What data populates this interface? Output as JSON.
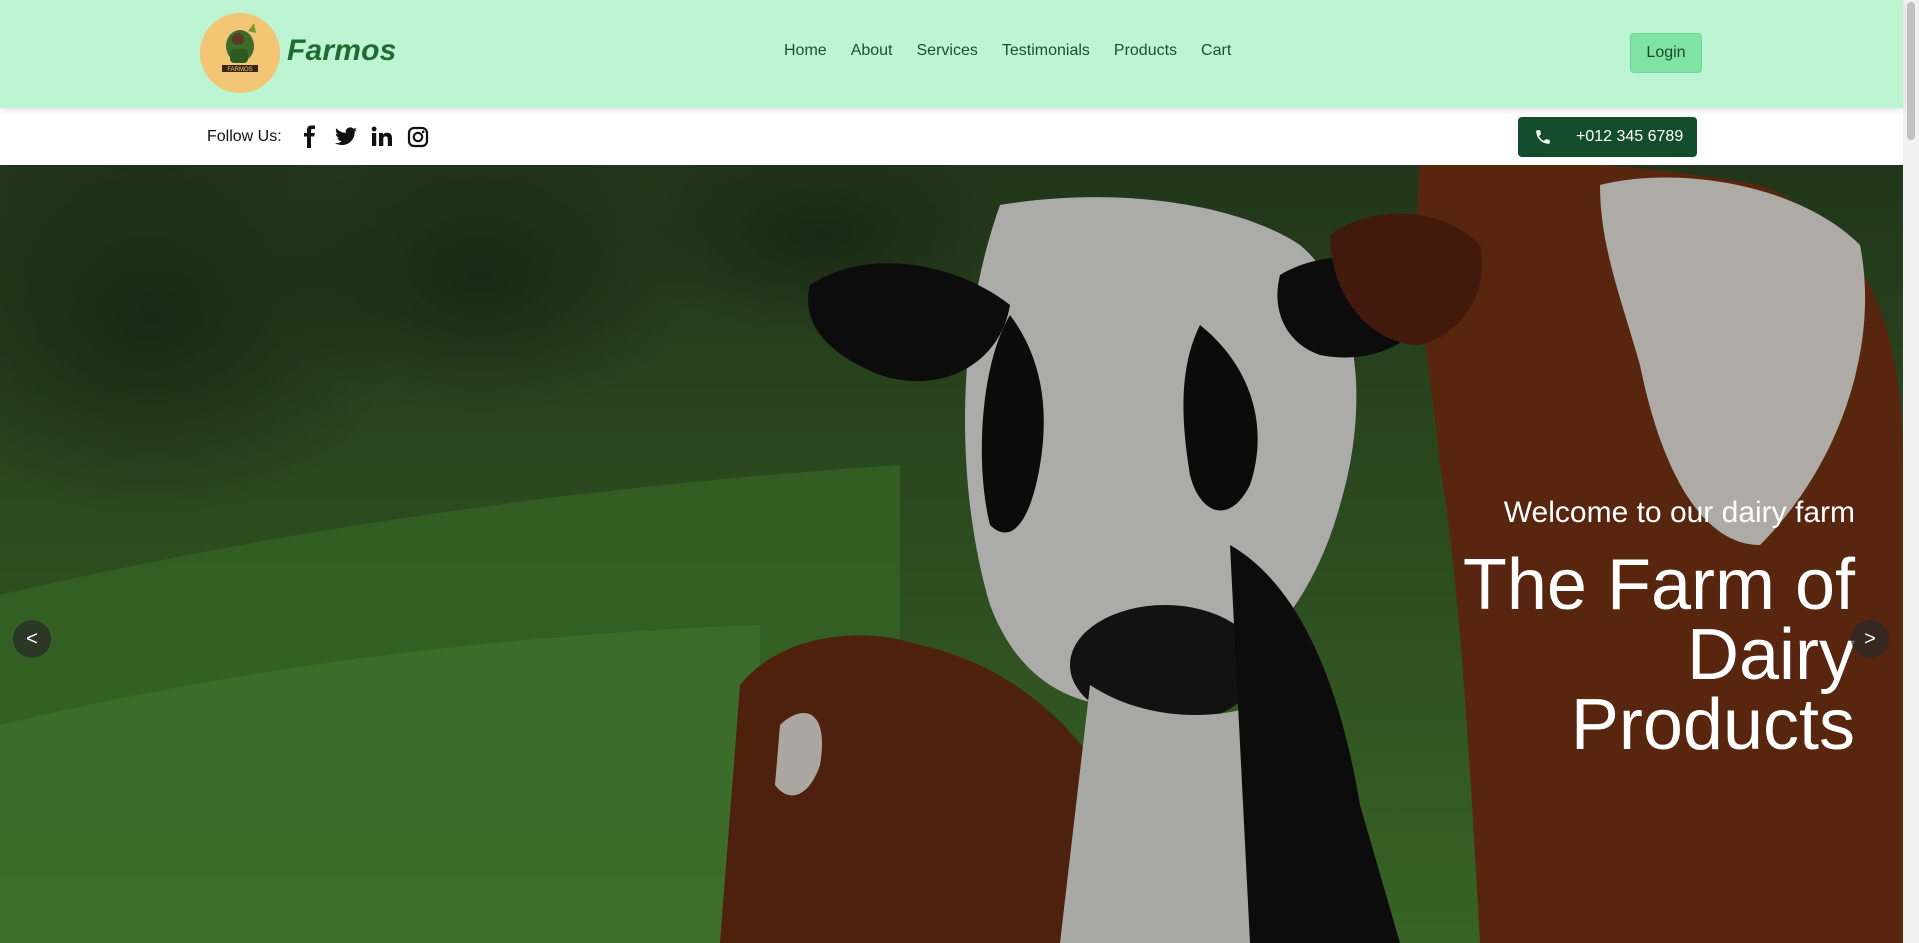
{
  "header": {
    "brand": "Farmos",
    "logo_text": "FARMOS",
    "nav": [
      "Home",
      "About",
      "Services",
      "Testimonials",
      "Products",
      "Cart"
    ],
    "login_label": "Login"
  },
  "social": {
    "follow_label": "Follow Us:",
    "icons": [
      "facebook-icon",
      "twitter-icon",
      "linkedin-icon",
      "instagram-icon"
    ],
    "phone": "+012 345 6789"
  },
  "hero": {
    "subtitle": "Welcome to our dairy farm",
    "title": "The Farm of Dairy Products",
    "prev_label": "<",
    "next_label": ">"
  },
  "colors": {
    "header_bg": "#bdf5d2",
    "brand": "#1f6b34",
    "login_bg": "#7fe3a3",
    "phone_bg": "#144d2b"
  }
}
